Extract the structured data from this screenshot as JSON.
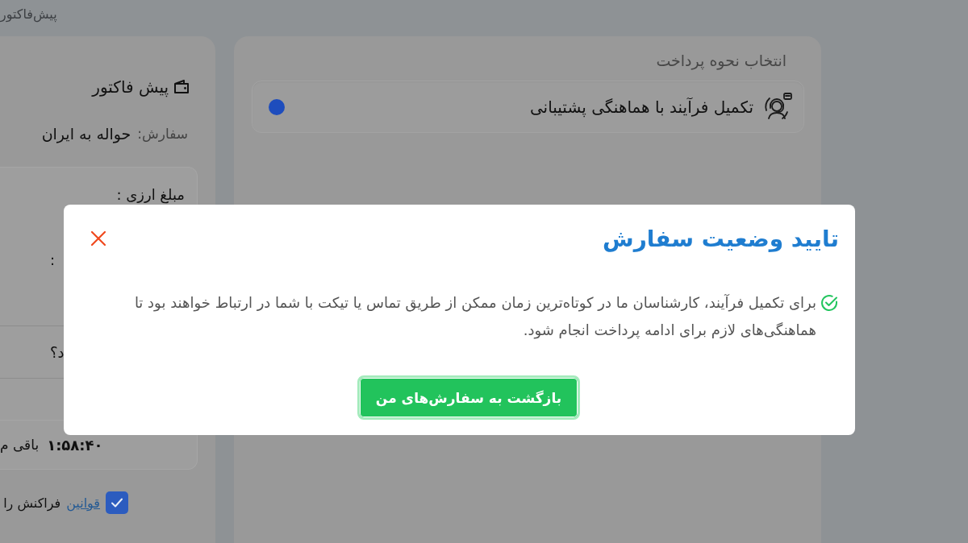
{
  "breadcrumb": {
    "label": "پیش‌فاکتور"
  },
  "invoice_panel": {
    "title": "پیش فاکتور",
    "order": {
      "label": "سفارش:",
      "value": "حواله به ایران"
    },
    "summary_rows": [
      {
        "label": "مبلغ ارزی :"
      },
      {
        "value": ":"
      },
      {
        "value": "د؟"
      }
    ],
    "timer": {
      "time": "۱:۵۸:۴۰",
      "label": "باقی م"
    },
    "terms": {
      "checked": true,
      "link": "قوانین",
      "text": "فراکنش را"
    }
  },
  "payment_panel": {
    "title": "انتخاب نحوه پرداخت",
    "options": [
      {
        "label": "تکمیل فرآیند با هماهنگی پشتیبانی",
        "selected": true
      }
    ]
  },
  "dialog": {
    "title": "تایید وضعیت سفارش",
    "message": "برای تکمیل فرآیند، کارشناسان ما در کوتاه‌ترین زمان ممکن از طریق تماس یا تیکت با شما در ارتباط خواهند بود تا هماهنگی‌های لازم برای ادامه پرداخت انجام شود.",
    "button": "بازگشت به سفارش‌های من"
  }
}
